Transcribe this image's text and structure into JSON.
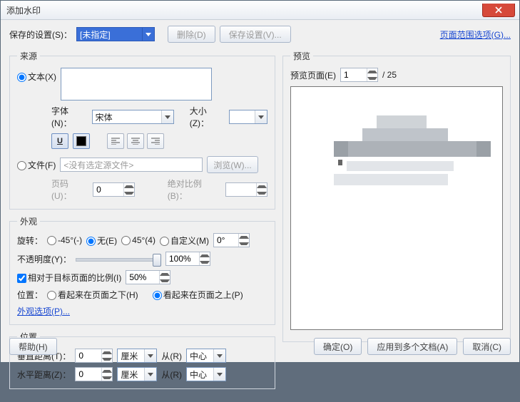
{
  "window": {
    "title": "添加水印"
  },
  "toprow": {
    "saved_settings_label": "保存的设置(S)：",
    "saved_settings_value": "[未指定]",
    "delete_btn": "删除(D)",
    "save_btn": "保存设置(V)...",
    "range_link": "页面范围选项(G)..."
  },
  "source": {
    "legend": "来源",
    "text_radio": "文本(X)",
    "font_label": "字体(N)：",
    "font_value": "宋体",
    "size_label": "大小(Z)：",
    "size_value": "",
    "file_radio": "文件(F)",
    "file_value": "<没有选定源文件>",
    "browse_btn": "浏览(W)...",
    "page_num_label": "页码(U)：",
    "page_num_value": "0",
    "abs_scale_label": "绝对比例(B)：",
    "abs_scale_value": ""
  },
  "appearance": {
    "legend": "外观",
    "rotate_label": "旋转：",
    "rot_m45": "-45°(-)",
    "rot_none": "无(E)",
    "rot_45": "45°(4)",
    "rot_custom": "自定义(M)",
    "rot_value": "0°",
    "opacity_label": "不透明度(Y)：",
    "opacity_value": "100%",
    "relative_scale_chk": "相对于目标页面的比例(I)",
    "relative_scale_value": "50%",
    "position_label": "位置：",
    "pos_below": "看起来在页面之下(H)",
    "pos_above": "看起来在页面之上(P)",
    "options_link": "外观选项(P)..."
  },
  "position": {
    "legend": "位置",
    "vdist_label": "垂直距离(T)：",
    "vdist_value": "0",
    "hdist_label": "水平距离(Z)：",
    "hdist_value": "0",
    "unit": "厘米",
    "from_label": "从(R)",
    "from_value": "中心"
  },
  "preview": {
    "legend": "预览",
    "page_label": "预览页面(E)",
    "page_value": "1",
    "page_total": " / 25"
  },
  "footer": {
    "help": "帮助(H)",
    "ok": "确定(O)",
    "apply_multi": "应用到多个文档(A)",
    "cancel": "取消(C)"
  }
}
